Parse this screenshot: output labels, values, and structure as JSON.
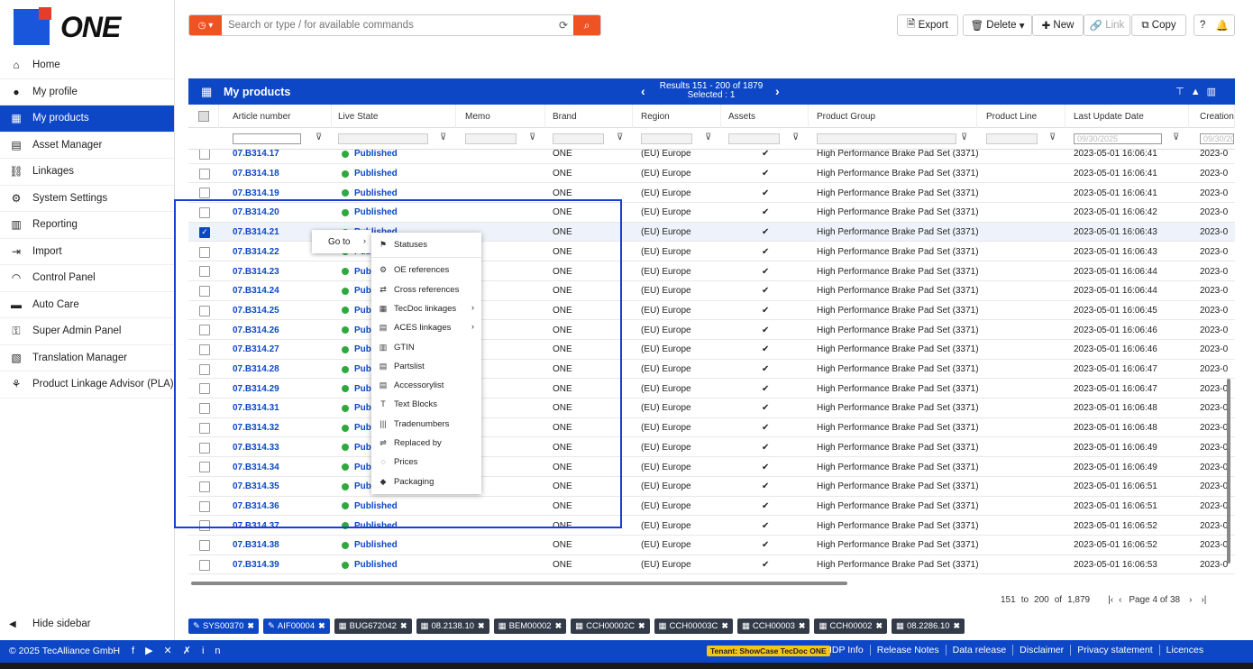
{
  "app": {
    "logo_text": "ONE"
  },
  "sidebar": {
    "items": [
      {
        "label": "Home",
        "icon": "home-icon"
      },
      {
        "label": "My profile",
        "icon": "user-icon"
      },
      {
        "label": "My products",
        "icon": "products-icon",
        "active": true
      },
      {
        "label": "Asset Manager",
        "icon": "assets-icon"
      },
      {
        "label": "Linkages",
        "icon": "link-icon"
      },
      {
        "label": "System Settings",
        "icon": "gear-icon"
      },
      {
        "label": "Reporting",
        "icon": "report-icon"
      },
      {
        "label": "Import",
        "icon": "import-icon"
      },
      {
        "label": "Control Panel",
        "icon": "gauge-icon"
      },
      {
        "label": "Auto Care",
        "icon": "car-icon"
      },
      {
        "label": "Super Admin Panel",
        "icon": "key-icon"
      },
      {
        "label": "Translation Manager",
        "icon": "translate-icon"
      },
      {
        "label": "Product Linkage Advisor (PLA)",
        "icon": "advisor-icon"
      }
    ],
    "hide_label": "Hide sidebar"
  },
  "search": {
    "placeholder": "Search or type / for available commands"
  },
  "toolbar": {
    "export": "Export",
    "delete": "Delete",
    "new": "New",
    "link": "Link",
    "copy": "Copy"
  },
  "panel": {
    "title": "My products",
    "results": "Results 151 - 200 of 1879",
    "selected": "Selected : 1"
  },
  "columns": [
    "Article number",
    "Live State",
    "Memo",
    "Brand",
    "Region",
    "Assets",
    "Product Group",
    "Product Line",
    "Last Update Date",
    "Creation"
  ],
  "filter_date_placeholder": "09/30/2025",
  "rows": [
    {
      "article": "07.B314.17",
      "state": "Published",
      "brand": "ONE",
      "region": "(EU) Europe",
      "group": "High Performance Brake Pad Set (3371)",
      "updated": "2023-05-01 16:06:41",
      "creation": "2023-0"
    },
    {
      "article": "07.B314.18",
      "state": "Published",
      "brand": "ONE",
      "region": "(EU) Europe",
      "group": "High Performance Brake Pad Set (3371)",
      "updated": "2023-05-01 16:06:41",
      "creation": "2023-0"
    },
    {
      "article": "07.B314.19",
      "state": "Published",
      "brand": "ONE",
      "region": "(EU) Europe",
      "group": "High Performance Brake Pad Set (3371)",
      "updated": "2023-05-01 16:06:41",
      "creation": "2023-0"
    },
    {
      "article": "07.B314.20",
      "state": "Published",
      "brand": "ONE",
      "region": "(EU) Europe",
      "group": "High Performance Brake Pad Set (3371)",
      "updated": "2023-05-01 16:06:42",
      "creation": "2023-0"
    },
    {
      "article": "07.B314.21",
      "state": "Published",
      "brand": "ONE",
      "region": "(EU) Europe",
      "group": "High Performance Brake Pad Set (3371)",
      "updated": "2023-05-01 16:06:43",
      "creation": "2023-0",
      "selected": true
    },
    {
      "article": "07.B314.22",
      "state": "Published",
      "brand": "ONE",
      "region": "(EU) Europe",
      "group": "High Performance Brake Pad Set (3371)",
      "updated": "2023-05-01 16:06:43",
      "creation": "2023-0"
    },
    {
      "article": "07.B314.23",
      "state": "Publ",
      "brand": "ONE",
      "region": "(EU) Europe",
      "group": "High Performance Brake Pad Set (3371)",
      "updated": "2023-05-01 16:06:44",
      "creation": "2023-0"
    },
    {
      "article": "07.B314.24",
      "state": "Publ",
      "brand": "ONE",
      "region": "(EU) Europe",
      "group": "High Performance Brake Pad Set (3371)",
      "updated": "2023-05-01 16:06:44",
      "creation": "2023-0"
    },
    {
      "article": "07.B314.25",
      "state": "Publ",
      "brand": "ONE",
      "region": "(EU) Europe",
      "group": "High Performance Brake Pad Set (3371)",
      "updated": "2023-05-01 16:06:45",
      "creation": "2023-0"
    },
    {
      "article": "07.B314.26",
      "state": "Publ",
      "brand": "ONE",
      "region": "(EU) Europe",
      "group": "High Performance Brake Pad Set (3371)",
      "updated": "2023-05-01 16:06:46",
      "creation": "2023-0"
    },
    {
      "article": "07.B314.27",
      "state": "Publ",
      "brand": "ONE",
      "region": "(EU) Europe",
      "group": "High Performance Brake Pad Set (3371)",
      "updated": "2023-05-01 16:06:46",
      "creation": "2023-0"
    },
    {
      "article": "07.B314.28",
      "state": "Publ",
      "brand": "ONE",
      "region": "(EU) Europe",
      "group": "High Performance Brake Pad Set (3371)",
      "updated": "2023-05-01 16:06:47",
      "creation": "2023-0"
    },
    {
      "article": "07.B314.29",
      "state": "Publ",
      "brand": "ONE",
      "region": "(EU) Europe",
      "group": "High Performance Brake Pad Set (3371)",
      "updated": "2023-05-01 16:06:47",
      "creation": "2023-0"
    },
    {
      "article": "07.B314.31",
      "state": "Publ",
      "brand": "ONE",
      "region": "(EU) Europe",
      "group": "High Performance Brake Pad Set (3371)",
      "updated": "2023-05-01 16:06:48",
      "creation": "2023-0"
    },
    {
      "article": "07.B314.32",
      "state": "Publ",
      "brand": "ONE",
      "region": "(EU) Europe",
      "group": "High Performance Brake Pad Set (3371)",
      "updated": "2023-05-01 16:06:48",
      "creation": "2023-0"
    },
    {
      "article": "07.B314.33",
      "state": "Publ",
      "brand": "ONE",
      "region": "(EU) Europe",
      "group": "High Performance Brake Pad Set (3371)",
      "updated": "2023-05-01 16:06:49",
      "creation": "2023-0"
    },
    {
      "article": "07.B314.34",
      "state": "Publ",
      "brand": "ONE",
      "region": "(EU) Europe",
      "group": "High Performance Brake Pad Set (3371)",
      "updated": "2023-05-01 16:06:49",
      "creation": "2023-0"
    },
    {
      "article": "07.B314.35",
      "state": "Publ",
      "brand": "ONE",
      "region": "(EU) Europe",
      "group": "High Performance Brake Pad Set (3371)",
      "updated": "2023-05-01 16:06:51",
      "creation": "2023-0"
    },
    {
      "article": "07.B314.36",
      "state": "Published",
      "brand": "ONE",
      "region": "(EU) Europe",
      "group": "High Performance Brake Pad Set (3371)",
      "updated": "2023-05-01 16:06:51",
      "creation": "2023-0"
    },
    {
      "article": "07.B314.37",
      "state": "Published",
      "brand": "ONE",
      "region": "(EU) Europe",
      "group": "High Performance Brake Pad Set (3371)",
      "updated": "2023-05-01 16:06:52",
      "creation": "2023-0"
    },
    {
      "article": "07.B314.38",
      "state": "Published",
      "brand": "ONE",
      "region": "(EU) Europe",
      "group": "High Performance Brake Pad Set (3371)",
      "updated": "2023-05-01 16:06:52",
      "creation": "2023-0"
    },
    {
      "article": "07.B314.39",
      "state": "Published",
      "brand": "ONE",
      "region": "(EU) Europe",
      "group": "High Performance Brake Pad Set (3371)",
      "updated": "2023-05-01 16:06:53",
      "creation": "2023-0"
    }
  ],
  "context_menu": {
    "goto_label": "Go to",
    "items": [
      {
        "label": "Statuses",
        "icon": "flag-icon"
      },
      {
        "label": "OE references",
        "icon": "oe-icon"
      },
      {
        "label": "Cross references",
        "icon": "cross-icon"
      },
      {
        "label": "TecDoc linkages",
        "icon": "tecdoc-icon",
        "submenu": true
      },
      {
        "label": "ACES linkages",
        "icon": "aces-icon",
        "submenu": true
      },
      {
        "label": "GTIN",
        "icon": "gtin-icon"
      },
      {
        "label": "Partslist",
        "icon": "list-icon"
      },
      {
        "label": "Accessorylist",
        "icon": "accessory-icon"
      },
      {
        "label": "Text Blocks",
        "icon": "text-icon"
      },
      {
        "label": "Tradenumbers",
        "icon": "barcode-icon"
      },
      {
        "label": "Replaced by",
        "icon": "replace-icon"
      },
      {
        "label": "Prices",
        "icon": "price-icon"
      },
      {
        "label": "Packaging",
        "icon": "package-icon"
      }
    ]
  },
  "pager": {
    "from": "151",
    "to_word": "to",
    "to": "200",
    "of_word": "of",
    "total": "1,879",
    "page_text": "Page 4 of 38"
  },
  "tabs": [
    {
      "label": "SYS00370",
      "pinned": true
    },
    {
      "label": "AIF00004",
      "pinned": true
    },
    {
      "label": "BUG672042",
      "pinned": false
    },
    {
      "label": "08.2138.10",
      "pinned": false
    },
    {
      "label": "BEM00002",
      "pinned": false
    },
    {
      "label": "CCH00002C",
      "pinned": false
    },
    {
      "label": "CCH00003C",
      "pinned": false
    },
    {
      "label": "CCH00003",
      "pinned": false
    },
    {
      "label": "CCH00002",
      "pinned": false
    },
    {
      "label": "08.2286.10",
      "pinned": false
    }
  ],
  "footer": {
    "copyright": "© 2025 TecAlliance GmbH",
    "tenant": "Tenant: ShowCase TecDoc ONE",
    "links": [
      "IDP Info",
      "Release Notes",
      "Data release",
      "Disclaimer",
      "Privacy statement",
      "Licences"
    ]
  },
  "colors": {
    "primary": "#0d47c6",
    "accent": "#f05323",
    "published": "#2eaa3d",
    "tenant": "#f5c518"
  }
}
